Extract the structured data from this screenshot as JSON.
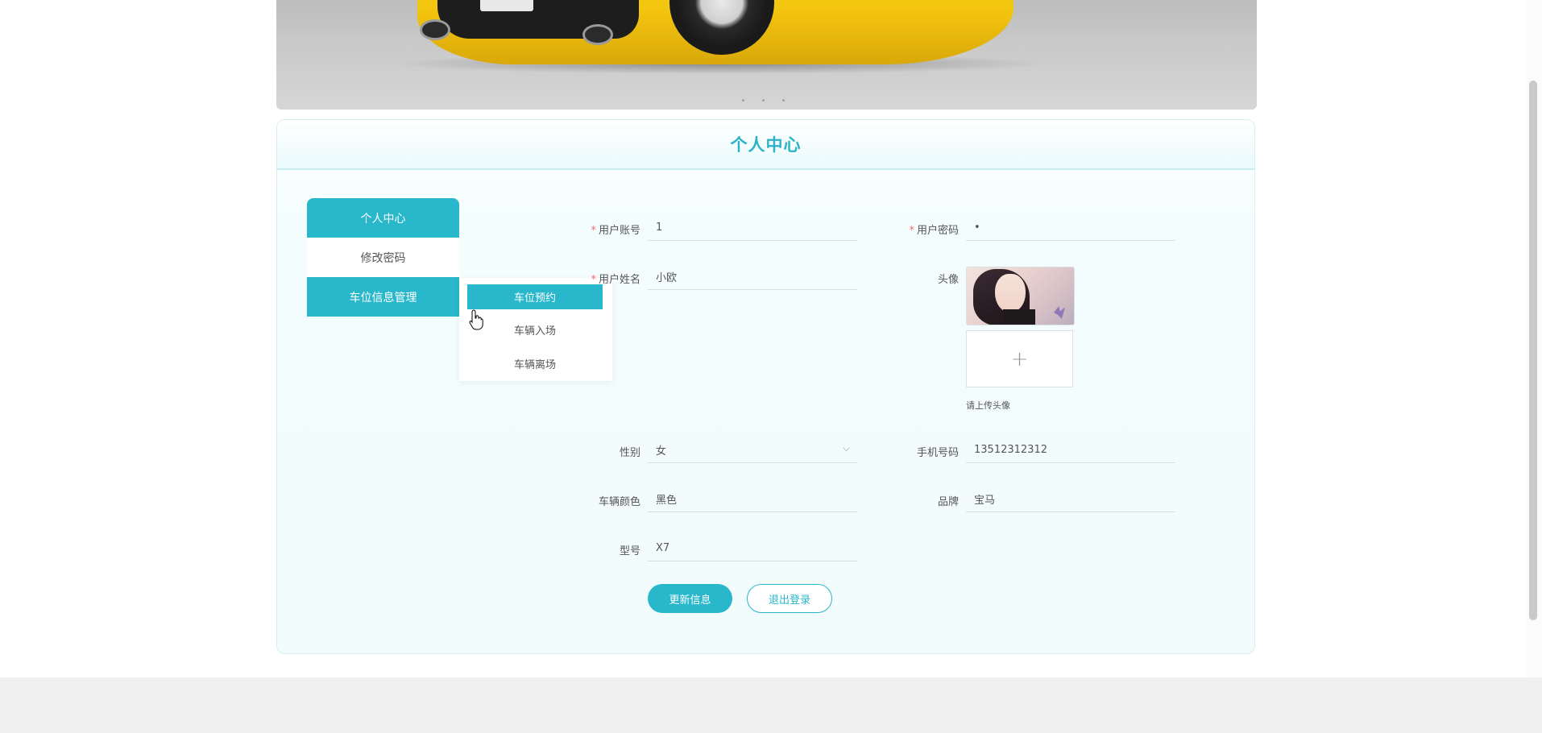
{
  "banner": {
    "dots": "• • •"
  },
  "card": {
    "title": "个人中心"
  },
  "sidebar": {
    "items": [
      {
        "label": "个人中心"
      },
      {
        "label": "修改密码"
      },
      {
        "label": "车位信息管理"
      }
    ],
    "submenu": [
      {
        "label": "车位预约"
      },
      {
        "label": "车辆入场"
      },
      {
        "label": "车辆离场"
      }
    ]
  },
  "form": {
    "required_mark": "*",
    "account": {
      "label": "用户账号",
      "value": "1"
    },
    "password": {
      "label": "用户密码",
      "value": "•"
    },
    "name": {
      "label": "用户姓名",
      "value": "小欧"
    },
    "avatar": {
      "label": "头像",
      "upload_tip": "请上传头像",
      "plus": "+"
    },
    "gender": {
      "label": "性别",
      "value": "女",
      "chevron": "⌵"
    },
    "phone": {
      "label": "手机号码",
      "value": "13512312312"
    },
    "color": {
      "label": "车辆颜色",
      "value": "黑色"
    },
    "brand": {
      "label": "品牌",
      "value": "宝马"
    },
    "model": {
      "label": "型号",
      "value": "X7"
    }
  },
  "actions": {
    "update": "更新信息",
    "logout": "退出登录"
  },
  "colors": {
    "accent": "#28b7cb",
    "required": "#f56c6c",
    "title": "#2ab3c7"
  }
}
